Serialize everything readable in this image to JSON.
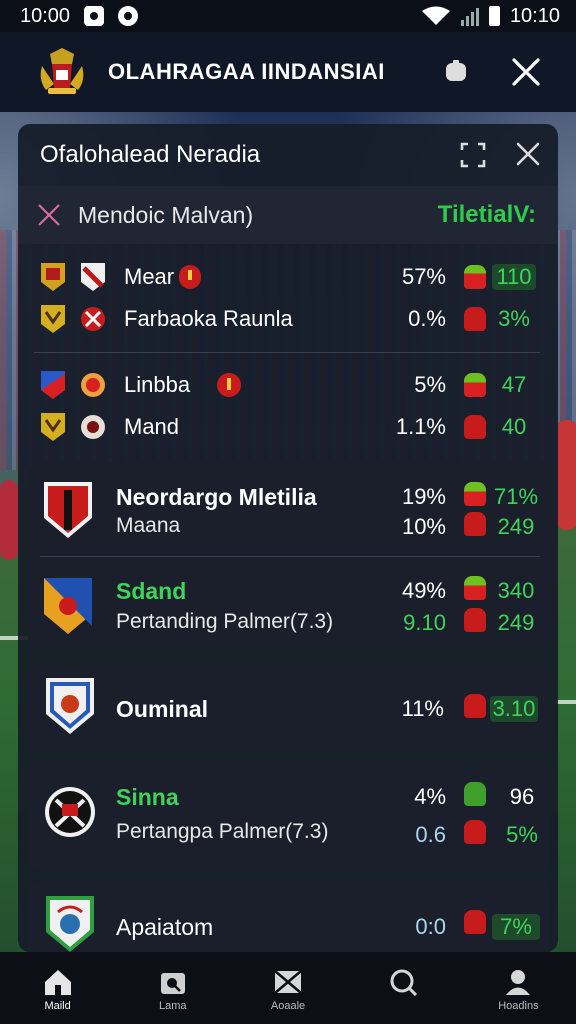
{
  "status": {
    "time_left": "10:00",
    "time_right": "10:10"
  },
  "app": {
    "title": "OLAHRAGAA IINDANSIAI"
  },
  "panel": {
    "title": "Ofalohalead Neradia",
    "filter": {
      "name": "Mendoic Malvan)",
      "badge": "TiletialV:"
    }
  },
  "matches": [
    {
      "teams": [
        {
          "name": "Mear",
          "pct": "57%",
          "score": "110",
          "boxed": true
        },
        {
          "name": "Farbaoka Raunla",
          "pct": "0.%",
          "score": "3%",
          "boxed": false
        }
      ]
    },
    {
      "teams": [
        {
          "name": "Linbba",
          "pct": "5%",
          "score": "47",
          "boxed": false
        },
        {
          "name": "Mand",
          "pct": "1.1%",
          "score": "40",
          "boxed": false
        }
      ]
    }
  ],
  "cards": [
    {
      "name": "Neordargo Mletilia",
      "sub": "Maana",
      "pct1": "19%",
      "score1": "71%",
      "pct2": "10%",
      "score2": "249"
    },
    {
      "name": "Sdand",
      "sub": "Pertanding Palmer(7.3)",
      "pct1": "49%",
      "score1": "340",
      "pct2": "9.10",
      "score2": "249"
    },
    {
      "name": "Ouminal",
      "pct1": "11%",
      "score1": "3.10"
    },
    {
      "name": "Sinna",
      "sub": "Pertangpa Palmer(7.3)",
      "pct1": "4%",
      "score1": "96",
      "pct2": "0.6",
      "score2": "5%"
    },
    {
      "name": "Apaiatom",
      "pct1": "0:0",
      "score1": "7%"
    }
  ],
  "nav": [
    {
      "label": "Maild",
      "icon": "home-icon"
    },
    {
      "label": "Lama",
      "icon": "camera-search-icon"
    },
    {
      "label": "Aoaale",
      "icon": "envelope-icon"
    },
    {
      "label": "",
      "icon": "search-icon"
    },
    {
      "label": "Hoadins",
      "icon": "profile-icon"
    }
  ],
  "colors": {
    "green": "#3ed35a",
    "red": "#e02020",
    "panel": "#161c28"
  }
}
